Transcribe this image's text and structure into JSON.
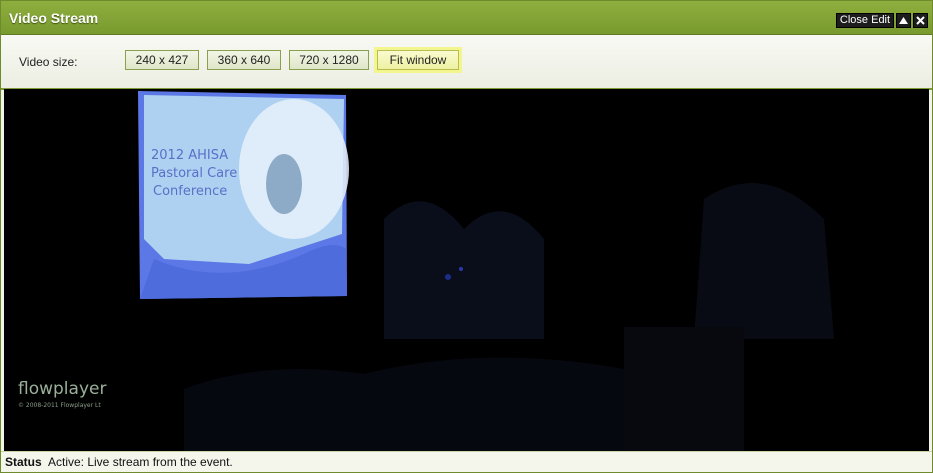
{
  "window": {
    "title": "Video Stream"
  },
  "titlebar_controls": {
    "close_edit": "Close Edit",
    "up_glyph": "▲",
    "close_glyph": "✕"
  },
  "toolbar": {
    "video_size_label": "Video size:",
    "sizes": [
      "240 x 427",
      "360 x 640",
      "720 x 1280",
      "Fit window"
    ],
    "selected": "Fit window"
  },
  "video": {
    "slide_lines": [
      "2012 AHISA",
      "Pastoral Care",
      "Conference"
    ],
    "player_brand": "flowplayer",
    "player_copyright": "© 2008-2011 Flowplayer Lt"
  },
  "status": {
    "label": "Status",
    "text": "Active: Live stream from the event."
  },
  "colors": {
    "titlebar": "#7d9e30",
    "selected_button": "#eef1a1",
    "video_bg": "#000000"
  }
}
